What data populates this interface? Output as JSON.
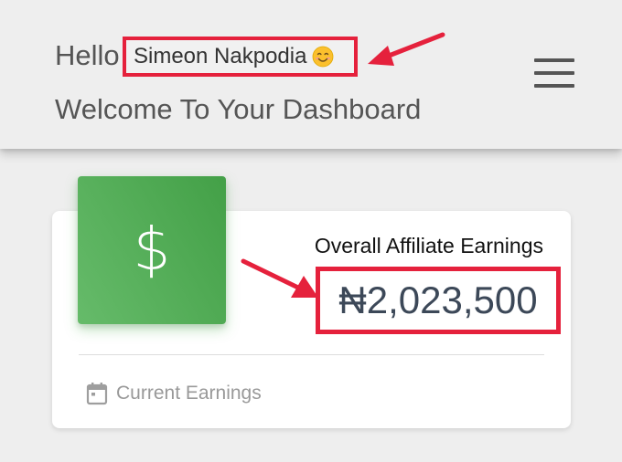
{
  "header": {
    "greeting": "Hello",
    "user_name": "Simeon Nakpodia",
    "welcome": "Welcome To Your Dashboard",
    "menu_icon": "hamburger-menu-icon"
  },
  "card": {
    "icon": "dollar-icon",
    "title": "Overall Affiliate Earnings",
    "amount": "₦2,023,500",
    "footer_icon": "calendar-icon",
    "footer_label": "Current Earnings"
  },
  "colors": {
    "highlight": "#e5213c",
    "accent_green": "#4caf50",
    "background": "#eeeeee",
    "card": "#ffffff"
  }
}
